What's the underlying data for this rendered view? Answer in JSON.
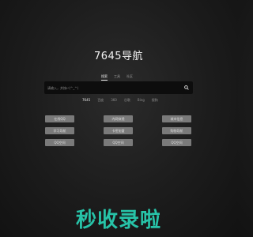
{
  "site": {
    "title": "7645导航"
  },
  "tabs": [
    {
      "label": "搜索"
    },
    {
      "label": "工具"
    },
    {
      "label": "社区"
    }
  ],
  "search": {
    "placeholder": "请输入，并按↵(^_^)",
    "value": ""
  },
  "engines": [
    {
      "label": "7645"
    },
    {
      "label": "百度"
    },
    {
      "label": "360"
    },
    {
      "label": "谷歌"
    },
    {
      "label": "Bing"
    },
    {
      "label": "搜狗"
    }
  ],
  "links": [
    {
      "label": "在线QQ"
    },
    {
      "label": "内网穿透"
    },
    {
      "label": "城市信息"
    },
    {
      "label": "学习导航"
    },
    {
      "label": "卡密加盟"
    },
    {
      "label": "购物导航"
    },
    {
      "label": "QQ空间"
    },
    {
      "label": "QQ空间"
    },
    {
      "label": "QQ空间"
    }
  ],
  "brand": {
    "label": "秒收录啦"
  },
  "colors": {
    "background": "#1c1c1c",
    "search_bg": "#0d0d0d",
    "button_bg": "#7a7a7a",
    "brand": "#27c3a8"
  }
}
